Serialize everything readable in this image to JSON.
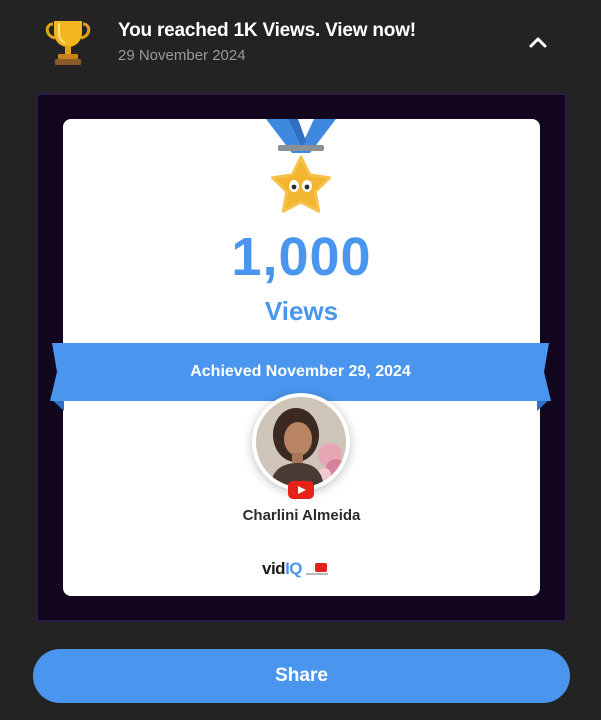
{
  "notification": {
    "title": "You reached 1K Views. View now!",
    "date": "29 November 2024",
    "icon": "trophy-icon",
    "collapse_icon": "chevron-up-icon"
  },
  "card": {
    "count": "1,000",
    "unit": "Views",
    "ribbon_text": "Achieved November 29, 2024",
    "user_name": "Charlini Almeida",
    "brand_vid": "vid",
    "brand_iq": "IQ",
    "platform_icon": "youtube-icon"
  },
  "actions": {
    "share_label": "Share"
  },
  "colors": {
    "background": "#232323",
    "accent": "#4a96ef",
    "frame": "#12071f",
    "card": "#ffffff"
  }
}
